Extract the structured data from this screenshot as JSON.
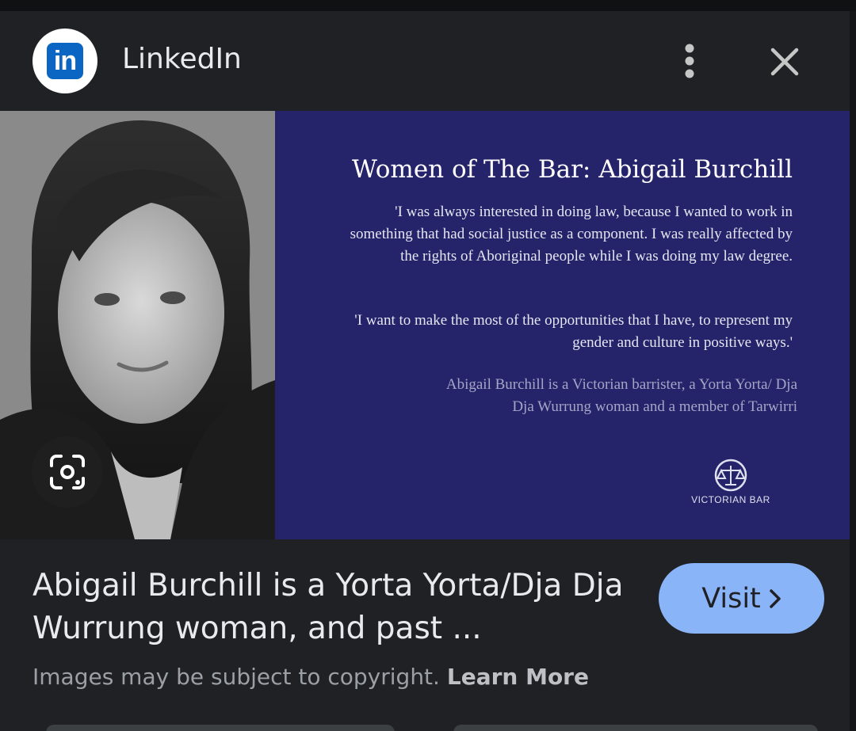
{
  "header": {
    "logo_text": "in",
    "source_name": "LinkedIn"
  },
  "image": {
    "title": "Women of The Bar: Abigail Burchill",
    "quote1": "'I was always interested in doing law, because I wanted to work in something that had social justice as a component. I was really affected by the rights of Aboriginal people while I was doing my law degree.",
    "quote2": "'I want to make the most of the opportunities that I have, to represent my gender and culture in positive ways.'",
    "bio": "Abigail Burchill is a Victorian barrister, a Yorta Yorta/ Dja Dja Wurrung woman and a member of Tarwirri",
    "org_logo_text": "VICTORIAN BAR"
  },
  "result": {
    "caption": "Abigail Burchill is a Yorta Yorta/Dja Dja Wurrung woman, and past ...",
    "visit_label": "Visit",
    "copyright_text": "Images may be subject to copyright.",
    "learn_more_label": "Learn More"
  },
  "icons": {
    "more": "more-vert-icon",
    "close": "close-icon",
    "lens": "lens-icon",
    "visit_chevron": "chevron-right-icon"
  },
  "colors": {
    "background": "#202124",
    "panel": "#25236a",
    "visit_button": "#8ab4f8",
    "linkedin_blue": "#0a66c2"
  }
}
